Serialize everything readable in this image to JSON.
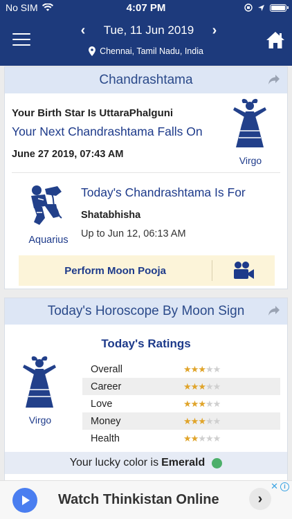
{
  "status_bar": {
    "carrier": "No SIM",
    "time": "4:07 PM"
  },
  "header": {
    "date": "Tue, 11 Jun 2019",
    "prev_label": "‹",
    "next_label": "›",
    "location": "Chennai, Tamil Nadu, India"
  },
  "chandrashtama": {
    "title": "Chandrashtama",
    "birth_star": "Your Birth Star Is UttaraPhalguni",
    "next_label": "Your Next Chandrashtama Falls On",
    "next_date": "June 27 2019, 07:43 AM",
    "sign": "Virgo",
    "today_label": "Today's Chandrashtama Is For",
    "today_sign": "Aquarius",
    "today_star": "Shatabhisha",
    "upto": "Up to Jun 12, 06:13 AM",
    "pooja_label": "Perform Moon Pooja"
  },
  "horoscope": {
    "title": "Today's Horoscope By Moon Sign",
    "ratings_title": "Today's Ratings",
    "sign": "Virgo",
    "ratings": [
      {
        "name": "Overall",
        "stars": 3,
        "max": 5
      },
      {
        "name": "Career",
        "stars": 3,
        "max": 5
      },
      {
        "name": "Love",
        "stars": 3,
        "max": 5
      },
      {
        "name": "Money",
        "stars": 3,
        "max": 5
      },
      {
        "name": "Health",
        "stars": 2,
        "max": 5
      }
    ],
    "lucky_prefix": "Your lucky color is",
    "lucky_color": "Emerald",
    "lucky_color_hex": "#4caf6a"
  },
  "ad": {
    "text": "Watch Thinkistan Online",
    "info_label": "i",
    "close_label": "✕",
    "next_label": "›"
  },
  "colors": {
    "brand": "#1d3a7c",
    "accent_text": "#1d3a8a",
    "section_header_bg": "#dde6f5",
    "star_on": "#e0a42a"
  },
  "icons": {
    "menu": "hamburger-icon",
    "home": "home-icon",
    "location": "location-pin-icon",
    "share": "share-arrow-icon",
    "video": "video-camera-icon"
  }
}
